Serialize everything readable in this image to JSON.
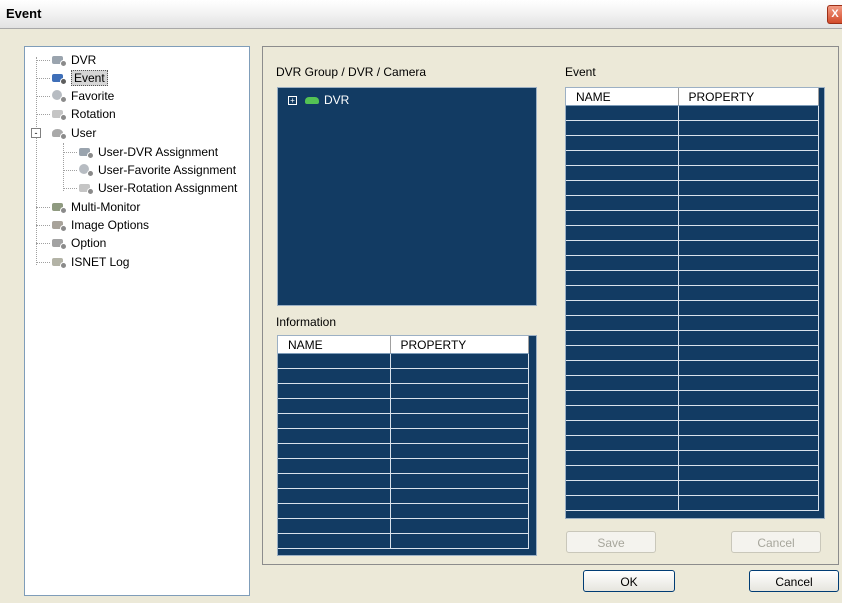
{
  "window": {
    "title": "Event",
    "close_glyph": "X"
  },
  "tree": {
    "items": [
      {
        "label": "DVR",
        "icon": "dvr-icon"
      },
      {
        "label": "Event",
        "icon": "event-icon",
        "selected": true
      },
      {
        "label": "Favorite",
        "icon": "favorite-icon"
      },
      {
        "label": "Rotation",
        "icon": "rotation-icon"
      },
      {
        "label": "User",
        "icon": "user-icon",
        "expander": "-"
      },
      {
        "label": "User-DVR Assignment",
        "icon": "user-dvr-icon"
      },
      {
        "label": "User-Favorite Assignment",
        "icon": "user-favorite-icon"
      },
      {
        "label": "User-Rotation Assignment",
        "icon": "user-rotation-icon"
      },
      {
        "label": "Multi-Monitor",
        "icon": "multi-monitor-icon"
      },
      {
        "label": "Image Options",
        "icon": "image-options-icon"
      },
      {
        "label": "Option",
        "icon": "option-icon"
      },
      {
        "label": "ISNET Log",
        "icon": "isnet-log-icon"
      }
    ]
  },
  "main": {
    "camera_section": {
      "label": "DVR Group / DVR / Camera",
      "root_node": "DVR",
      "root_expander": "+"
    },
    "information": {
      "label": "Information",
      "columns": [
        "NAME",
        "PROPERTY"
      ]
    },
    "event": {
      "label": "Event",
      "columns": [
        "NAME",
        "PROPERTY"
      ]
    },
    "save_button": "Save",
    "cancel_inner_button": "Cancel"
  },
  "footer": {
    "ok_button": "OK",
    "cancel_button": "Cancel"
  },
  "colors": {
    "panel_dark": "#123b63",
    "window_bg": "#ece9d8",
    "dvr_node_icon": "#54c254"
  }
}
